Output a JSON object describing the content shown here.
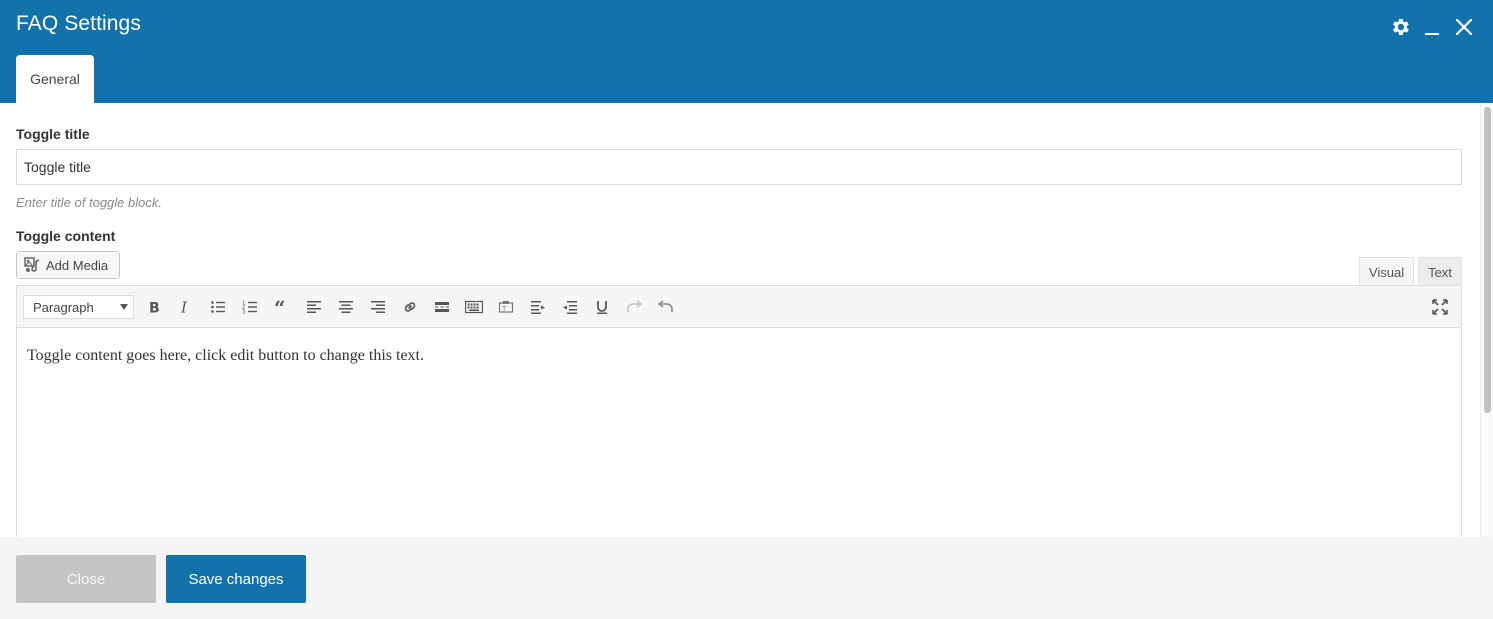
{
  "window": {
    "title": "FAQ Settings",
    "icons": [
      "gear-icon",
      "minimize-icon",
      "close-icon"
    ]
  },
  "tabs": [
    {
      "label": "General",
      "active": true
    }
  ],
  "form": {
    "title_field": {
      "label": "Toggle title",
      "value": "Toggle title",
      "hint": "Enter title of toggle block."
    },
    "content_field": {
      "label": "Toggle content",
      "add_media_label": "Add Media",
      "mode_tabs": [
        "Visual",
        "Text"
      ],
      "active_mode": "Visual",
      "format_select": "Paragraph",
      "toolbar_icons": [
        "bold-icon",
        "italic-icon",
        "bullet-list-icon",
        "numbered-list-icon",
        "blockquote-icon",
        "align-left-icon",
        "align-center-icon",
        "align-right-icon",
        "link-icon",
        "read-more-icon",
        "toolbar-toggle-icon",
        "paste-text-icon",
        "indent-icon",
        "outdent-icon",
        "underline-icon",
        "redo-icon",
        "undo-icon",
        "fullscreen-icon"
      ],
      "body_text": "Toggle content goes here, click edit button to change this text."
    }
  },
  "footer": {
    "close_label": "Close",
    "save_label": "Save changes"
  },
  "colors": {
    "header": "#1273aa",
    "primary_button": "#1273aa",
    "secondary_button": "#c4c4c4"
  }
}
